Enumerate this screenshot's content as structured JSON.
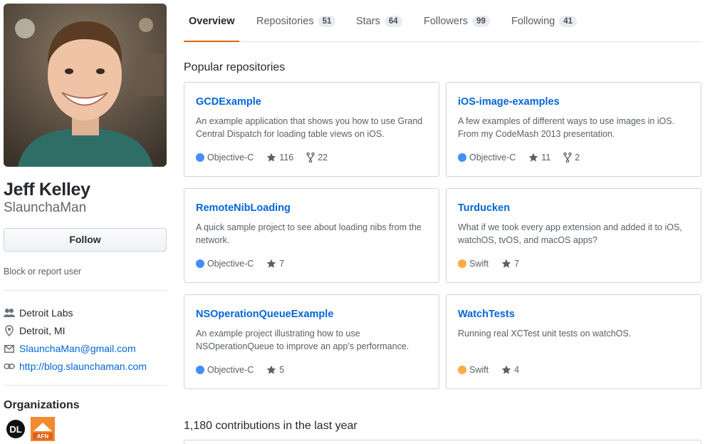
{
  "profile": {
    "full_name": "Jeff Kelley",
    "username": "SlaunchaMan",
    "follow_label": "Follow",
    "block_label": "Block or report user",
    "details": [
      {
        "icon": "organization-icon",
        "text": "Detroit Labs",
        "link": false
      },
      {
        "icon": "location-icon",
        "text": "Detroit, MI",
        "link": false
      },
      {
        "icon": "mail-icon",
        "text": "SlaunchaMan@gmail.com",
        "link": true
      },
      {
        "icon": "link-icon",
        "text": "http://blog.slaunchaman.com",
        "link": true
      }
    ],
    "organizations_title": "Organizations",
    "organizations": [
      {
        "name": "DL",
        "icon": "detroit-labs-org-icon"
      },
      {
        "name": "AFN",
        "icon": "afn-org-icon"
      }
    ]
  },
  "tabs": [
    {
      "label": "Overview",
      "count": "",
      "active": true
    },
    {
      "label": "Repositories",
      "count": "51",
      "active": false
    },
    {
      "label": "Stars",
      "count": "64",
      "active": false
    },
    {
      "label": "Followers",
      "count": "99",
      "active": false
    },
    {
      "label": "Following",
      "count": "41",
      "active": false
    }
  ],
  "popular_title": "Popular repositories",
  "repos": [
    {
      "name": "GCDExample",
      "desc": "An example application that shows you how to use Grand Central Dispatch for loading table views on iOS.",
      "lang": "Objective-C",
      "lang_color": "#438eff",
      "stars": "116",
      "forks": "22"
    },
    {
      "name": "iOS-image-examples",
      "desc": "A few examples of different ways to use images in iOS. From my CodeMash 2013 presentation.",
      "lang": "Objective-C",
      "lang_color": "#438eff",
      "stars": "11",
      "forks": "2"
    },
    {
      "name": "RemoteNibLoading",
      "desc": "A quick sample project to see about loading nibs from the network.",
      "lang": "Objective-C",
      "lang_color": "#438eff",
      "stars": "7",
      "forks": ""
    },
    {
      "name": "Turducken",
      "desc": "What if we took every app extension and added it to iOS, watchOS, tvOS, and macOS apps?",
      "lang": "Swift",
      "lang_color": "#ffac45",
      "stars": "7",
      "forks": ""
    },
    {
      "name": "NSOperationQueueExample",
      "desc": "An example project illustrating how to use NSOperationQueue to improve an app’s performance.",
      "lang": "Objective-C",
      "lang_color": "#438eff",
      "stars": "5",
      "forks": ""
    },
    {
      "name": "WatchTests",
      "desc": "Running real XCTest unit tests on watchOS.",
      "lang": "Swift",
      "lang_color": "#ffac45",
      "stars": "4",
      "forks": ""
    }
  ],
  "contributions_title": "1,180 contributions in the last year",
  "colors": {
    "link": "#0366d6",
    "accent": "#e36209"
  }
}
